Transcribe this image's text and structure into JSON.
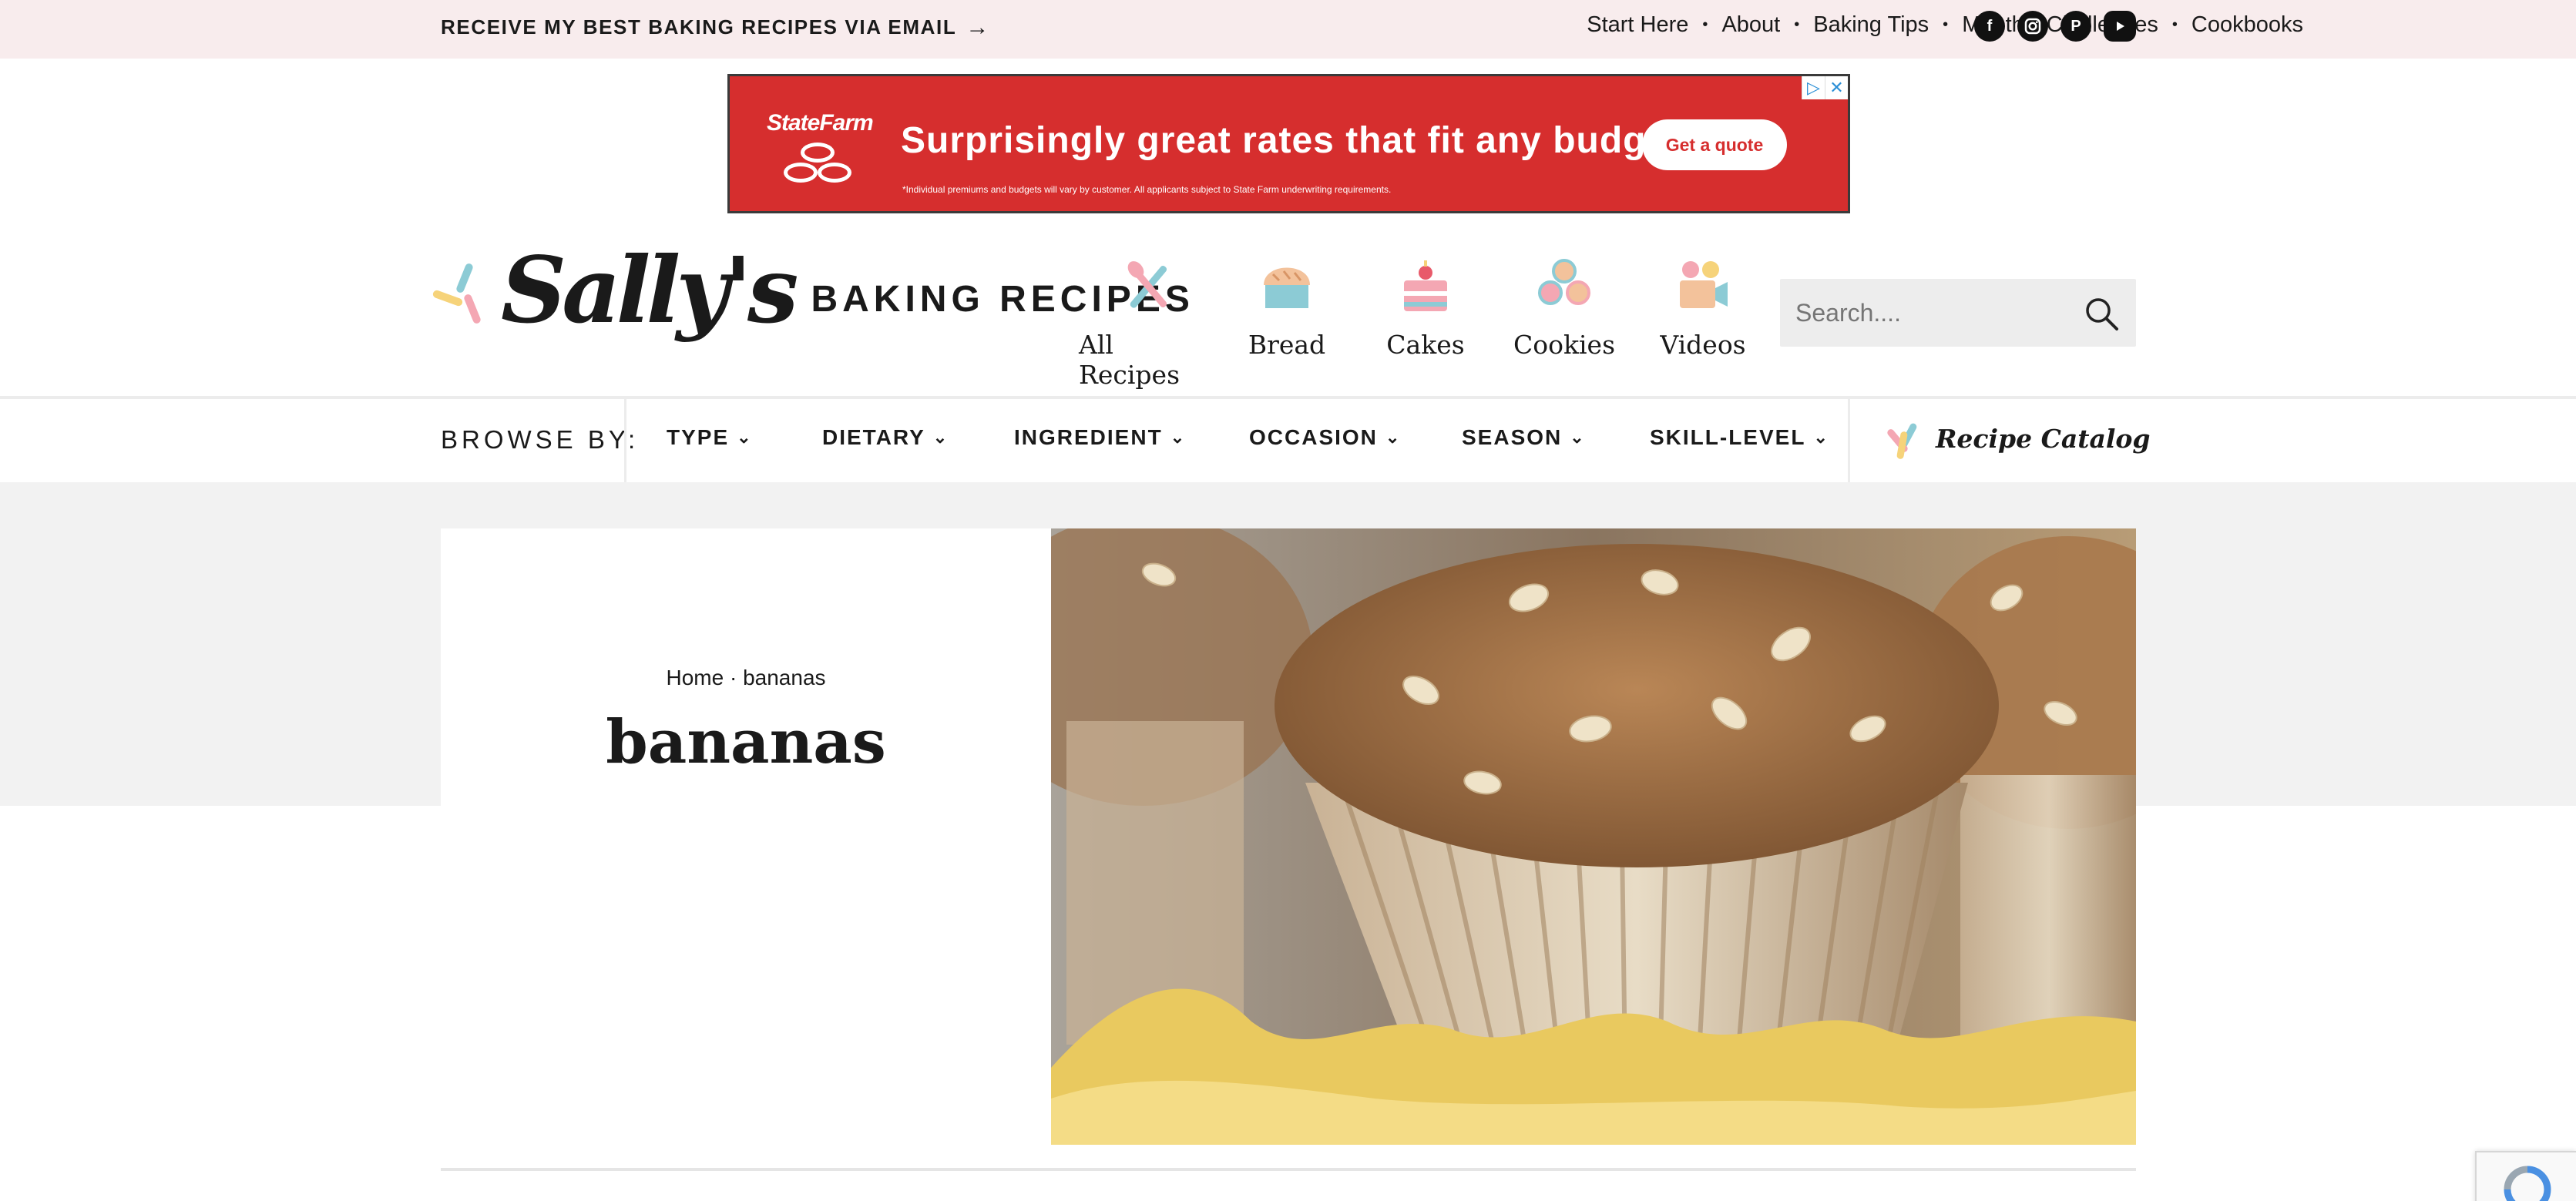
{
  "topbar": {
    "newsletter_label": "RECEIVE MY BEST BAKING RECIPES VIA EMAIL",
    "nav": [
      "Start Here",
      "About",
      "Baking Tips",
      "Monthly Challenges",
      "Cookbooks"
    ],
    "socials": [
      "facebook-icon",
      "instagram-icon",
      "pinterest-icon",
      "youtube-icon"
    ]
  },
  "ad": {
    "brand": "StateFarm",
    "headline": "Surprisingly great rates that fit any budget.",
    "fineprint": "*Individual premiums and budgets will vary by customer. All applicants subject to State Farm underwriting requirements.",
    "cta": "Get a quote"
  },
  "header": {
    "logo_script": "Sally's",
    "logo_word": "BAKING RECIPES",
    "categories": [
      {
        "label": "All Recipes",
        "icon": "whisk-spoon-icon"
      },
      {
        "label": "Bread",
        "icon": "bread-icon"
      },
      {
        "label": "Cakes",
        "icon": "cake-icon"
      },
      {
        "label": "Cookies",
        "icon": "cookies-icon"
      },
      {
        "label": "Videos",
        "icon": "video-camera-icon"
      }
    ],
    "search_placeholder": "Search...."
  },
  "browse": {
    "label": "BROWSE BY:",
    "facets": [
      "TYPE",
      "DIETARY",
      "INGREDIENT",
      "OCCASION",
      "SEASON",
      "SKILL-LEVEL"
    ],
    "catalog_label": "Recipe Catalog"
  },
  "hero": {
    "breadcrumb_home": "Home",
    "breadcrumb_sep": "·",
    "breadcrumb_current": "bananas",
    "title": "bananas",
    "image_subject": "banana oat muffins"
  },
  "colors": {
    "topbar_bg": "#f8eced",
    "ad_red": "#d62e2e",
    "sprinkle_pink": "#f4a7b3",
    "sprinkle_blue": "#8ccbd5",
    "sprinkle_yellow": "#f6d37a",
    "hero_gray": "#f2f2f2"
  }
}
